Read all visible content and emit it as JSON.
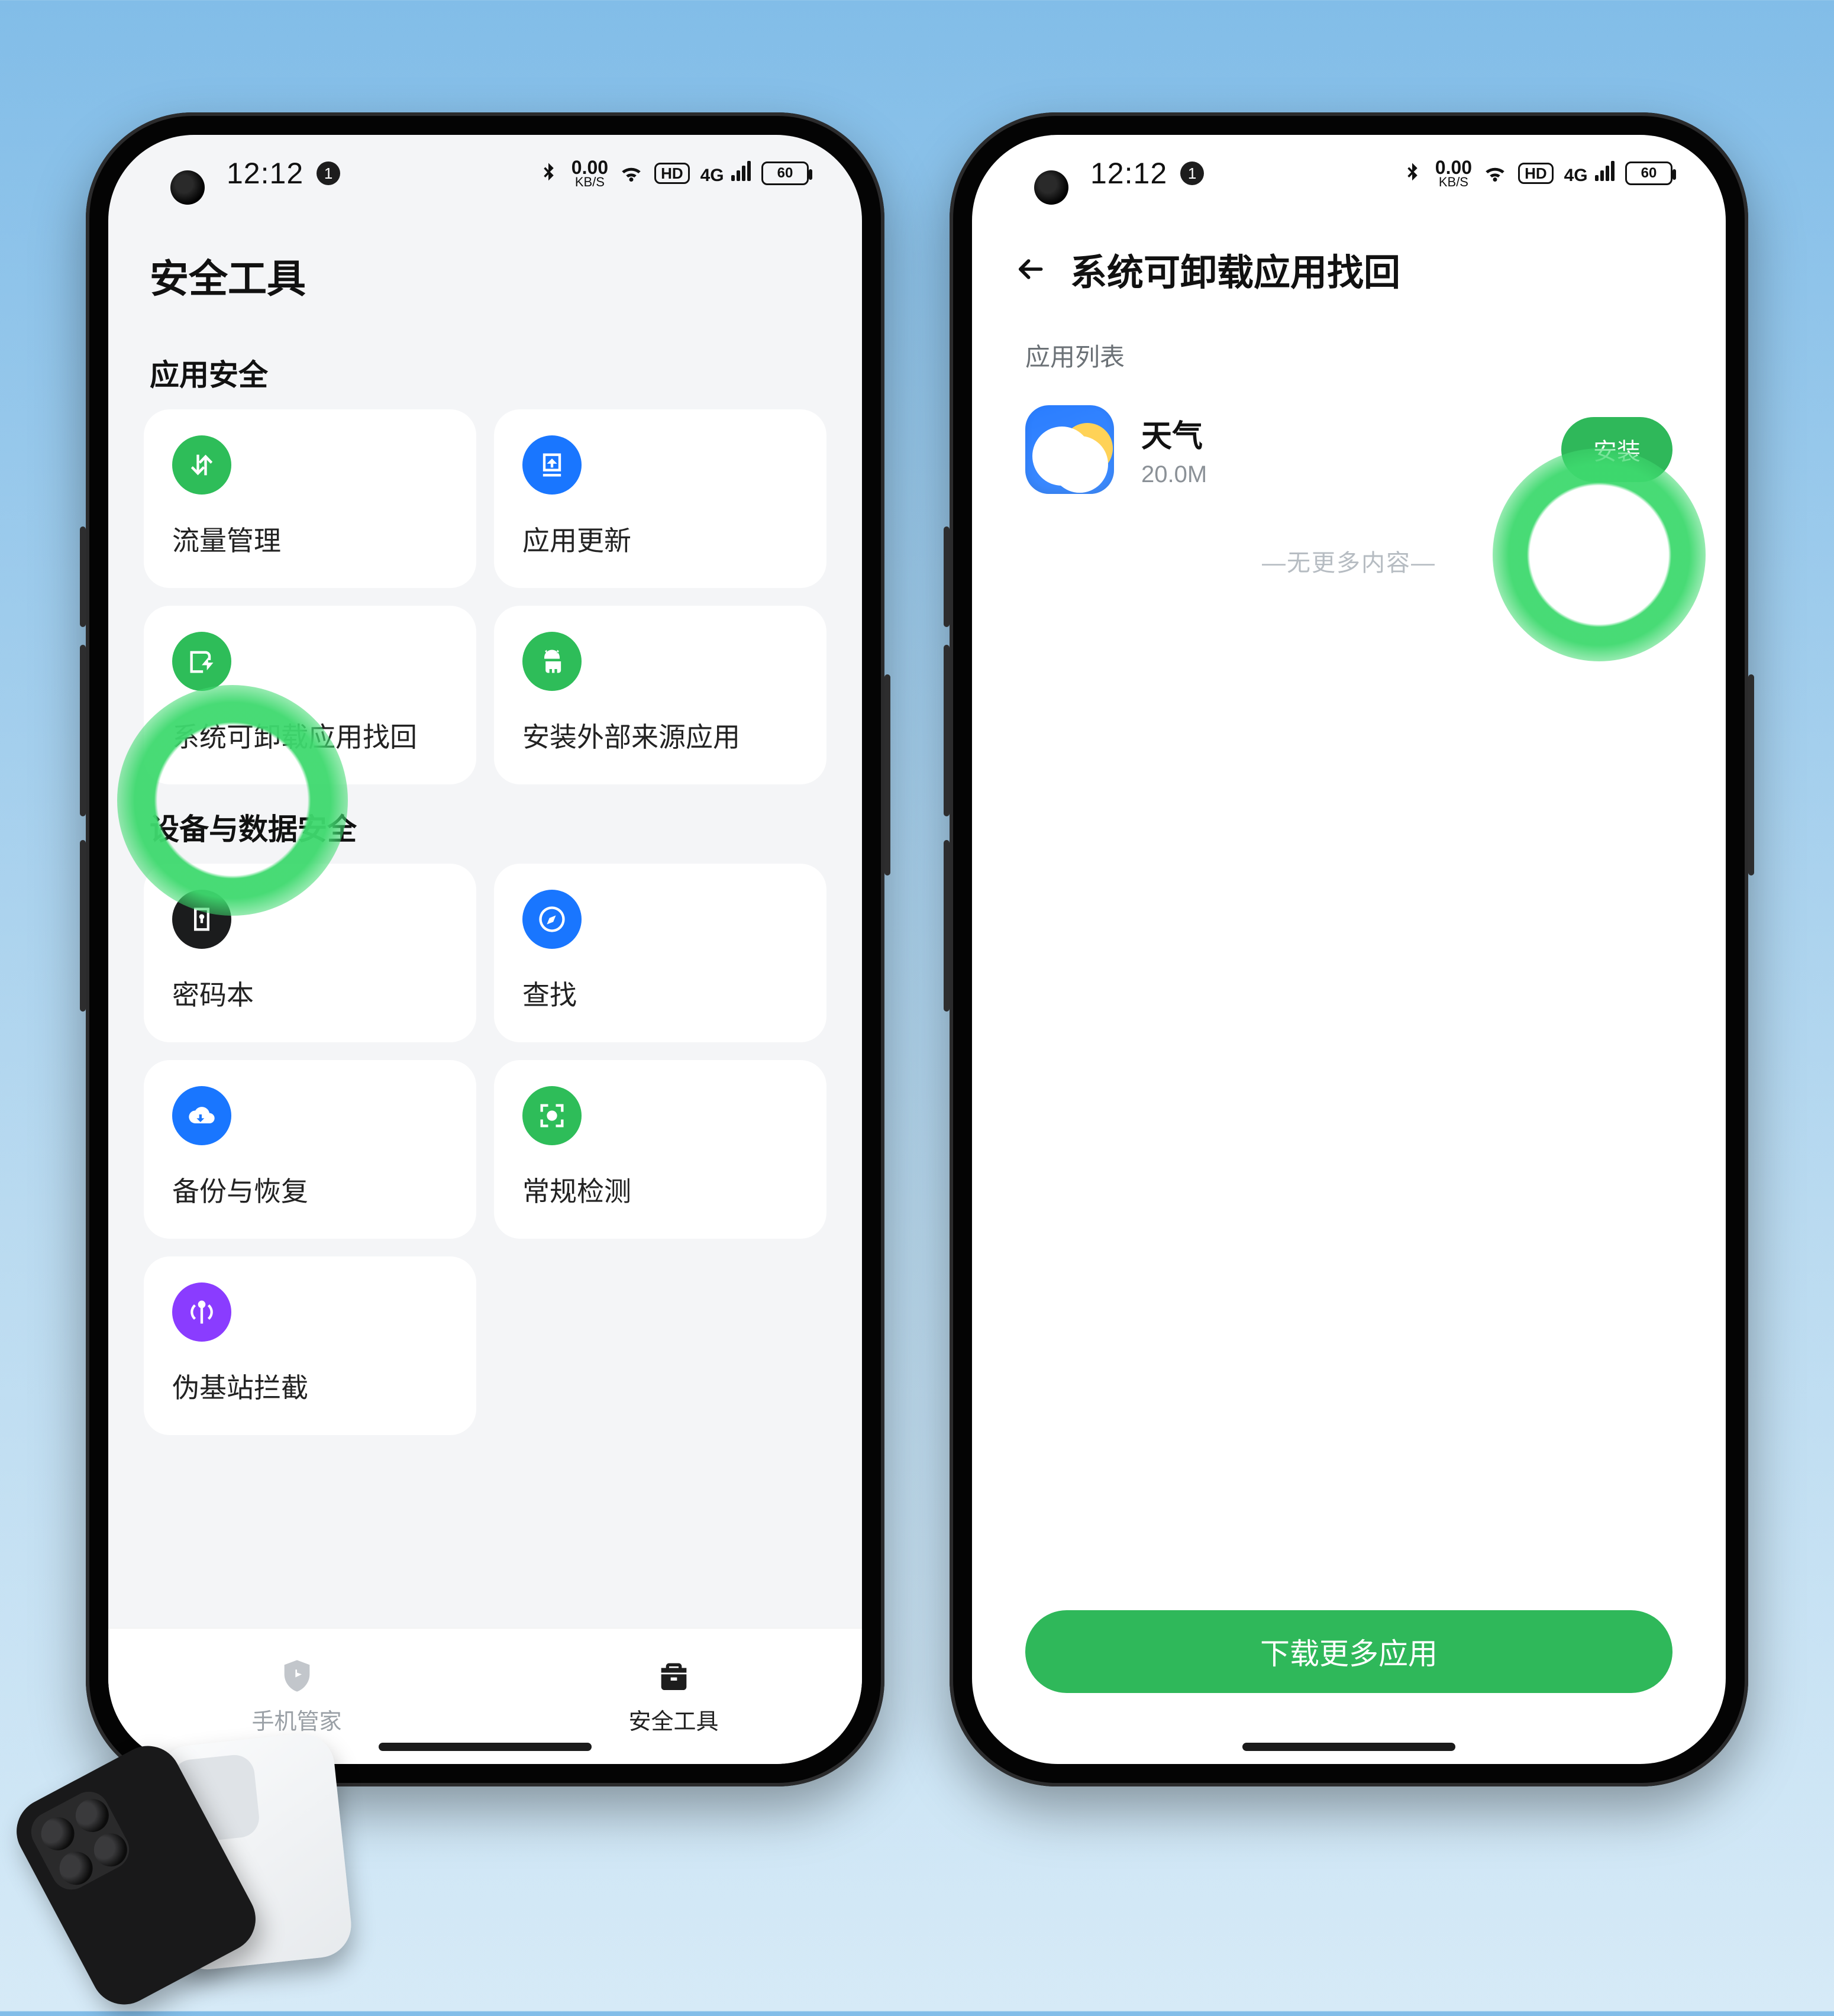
{
  "status": {
    "time": "12:12",
    "notif_count": "1",
    "net_speed_value": "0.00",
    "net_speed_unit": "KB/S",
    "hd_badge": "HD",
    "net_gen": "4G",
    "battery": "60"
  },
  "screen_a": {
    "title": "安全工具",
    "section_app": "应用安全",
    "section_device": "设备与数据安全",
    "cards": {
      "traffic": "流量管理",
      "update": "应用更新",
      "restore": "系统可卸载应用找回",
      "external": "安装外部来源应用",
      "password": "密码本",
      "find": "查找",
      "backup": "备份与恢复",
      "scan": "常规检测",
      "fakebs": "伪基站拦截"
    },
    "tabs": {
      "manager": "手机管家",
      "tools": "安全工具"
    }
  },
  "screen_b": {
    "title": "系统可卸载应用找回",
    "list_label": "应用列表",
    "app": {
      "name": "天气",
      "size": "20.0M",
      "install_label": "安装"
    },
    "no_more": "—无更多内容—",
    "more_btn": "下载更多应用"
  }
}
